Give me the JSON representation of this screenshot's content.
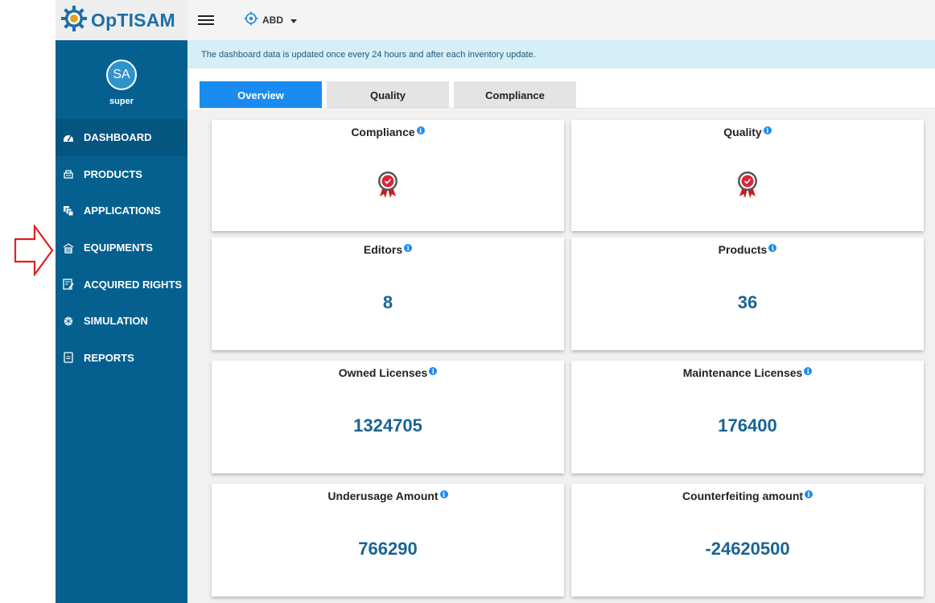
{
  "app": {
    "name": "OpTISAM"
  },
  "topbar": {
    "scope": "ABD"
  },
  "user": {
    "initials": "SA",
    "name": "super"
  },
  "sidebar": {
    "items": [
      {
        "label": "DASHBOARD",
        "icon": "dashboard-icon",
        "active": true
      },
      {
        "label": "PRODUCTS",
        "icon": "products-icon"
      },
      {
        "label": "APPLICATIONS",
        "icon": "applications-icon"
      },
      {
        "label": "EQUIPMENTS",
        "icon": "equipments-icon"
      },
      {
        "label": "ACQUIRED RIGHTS",
        "icon": "acquired-rights-icon"
      },
      {
        "label": "SIMULATION",
        "icon": "simulation-icon"
      },
      {
        "label": "REPORTS",
        "icon": "reports-icon"
      }
    ]
  },
  "notice": "The dashboard data is updated once every 24 hours and after each inventory update.",
  "tabs": [
    {
      "label": "Overview",
      "active": true
    },
    {
      "label": "Quality"
    },
    {
      "label": "Compliance"
    }
  ],
  "cards": {
    "compliance": {
      "title": "Compliance"
    },
    "quality": {
      "title": "Quality"
    },
    "editors": {
      "title": "Editors",
      "value": "8"
    },
    "products": {
      "title": "Products",
      "value": "36"
    },
    "owned": {
      "title": "Owned Licenses",
      "value": "1324705"
    },
    "maintenance": {
      "title": "Maintenance Licenses",
      "value": "176400"
    },
    "underusage": {
      "title": "Underusage Amount",
      "value": "766290"
    },
    "counterfeiting": {
      "title": "Counterfeiting amount",
      "value": "-24620500"
    }
  },
  "colors": {
    "sidebar": "#05608f",
    "accent": "#1a8cf0",
    "value": "#1a6494",
    "annotation_arrow": "#e02020"
  }
}
